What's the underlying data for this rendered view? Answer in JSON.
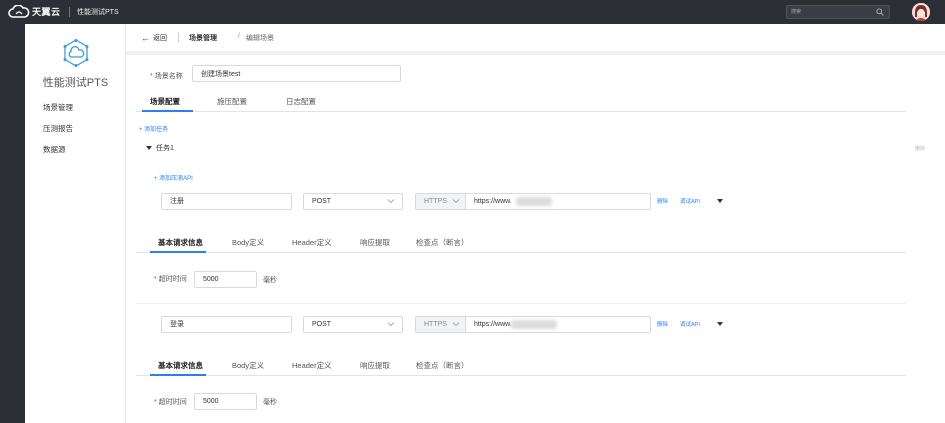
{
  "topbar": {
    "brand": "天翼云",
    "app_name": "性能测试PTS",
    "search_placeholder": "搜索",
    "icons": {
      "search": "search-icon",
      "avatar": "user-avatar",
      "logo": "cloud-logo"
    }
  },
  "sidebar": {
    "title": "性能测试PTS",
    "items": [
      {
        "label": "场景管理"
      },
      {
        "label": "压测报告"
      },
      {
        "label": "数据源"
      }
    ]
  },
  "breadcrumb": {
    "back_label": "返回",
    "items": [
      "场景管理",
      "编辑场景"
    ],
    "separator": "/"
  },
  "scene": {
    "name_label": "场景名称",
    "name_value": "创建场景test"
  },
  "main_tabs": [
    "场景配置",
    "施压配置",
    "日志配置"
  ],
  "add_task_label": "+ 添加任务",
  "task": {
    "name": "任务1",
    "right_action": "删除",
    "add_api_label": "+ 添加压测API",
    "apis": [
      {
        "name": "注册",
        "method": "POST",
        "protocol": "HTTPS",
        "url": "https://www.",
        "delete_label": "删除",
        "debug_label": "调试API",
        "sub_tabs": [
          "基本请求信息",
          "Body定义",
          "Header定义",
          "响应提取",
          "检查点（断言）"
        ],
        "timeout_label": "超时时间",
        "timeout_value": "5000",
        "timeout_unit": "毫秒"
      },
      {
        "name": "登录",
        "method": "POST",
        "protocol": "HTTPS",
        "url": "https://www.",
        "delete_label": "删除",
        "debug_label": "调试API",
        "sub_tabs": [
          "基本请求信息",
          "Body定义",
          "Header定义",
          "响应提取",
          "检查点（断言）"
        ],
        "timeout_label": "超时时间",
        "timeout_value": "5000",
        "timeout_unit": "毫秒"
      }
    ]
  },
  "colors": {
    "topbar": "#2c2f36",
    "accent": "#2d7ff0",
    "required": "#e33333",
    "sidebar_logo": "#3d9ad6"
  }
}
